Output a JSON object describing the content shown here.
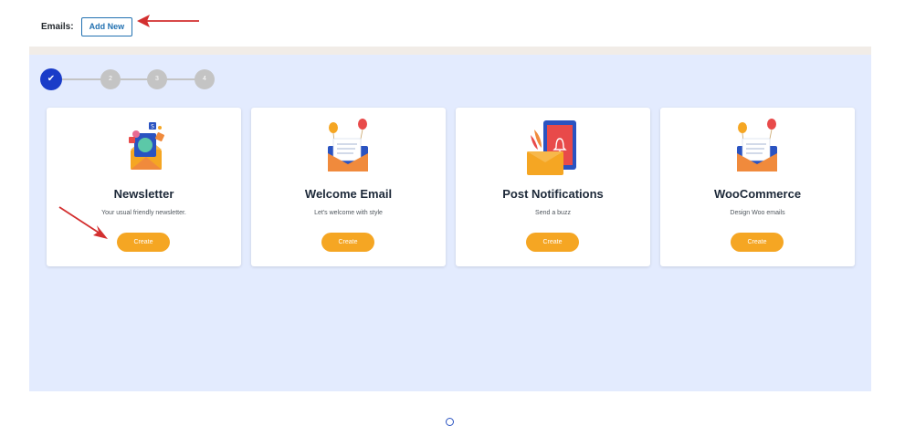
{
  "header": {
    "label": "Emails:",
    "add_new": "Add New"
  },
  "steps": [
    {
      "label": "✔",
      "active": true
    },
    {
      "label": "2",
      "active": false
    },
    {
      "label": "3",
      "active": false
    },
    {
      "label": "4",
      "active": false
    }
  ],
  "cards": [
    {
      "title": "Newsletter",
      "description": "Your usual friendly newsletter.",
      "button": "Create",
      "icon": "newsletter-icon"
    },
    {
      "title": "Welcome Email",
      "description": "Let's welcome with style",
      "button": "Create",
      "icon": "welcome-envelope-icon"
    },
    {
      "title": "Post Notifications",
      "description": "Send a buzz",
      "button": "Create",
      "icon": "notification-bell-icon"
    },
    {
      "title": "WooCommerce",
      "description": "Design Woo emails",
      "button": "Create",
      "icon": "woocommerce-envelope-icon"
    }
  ],
  "colors": {
    "accent": "#f5a623",
    "primary": "#1a3cc8",
    "panel": "#e3ebfe",
    "annotation_arrow": "#d32f2f",
    "link": "#2271b1"
  }
}
